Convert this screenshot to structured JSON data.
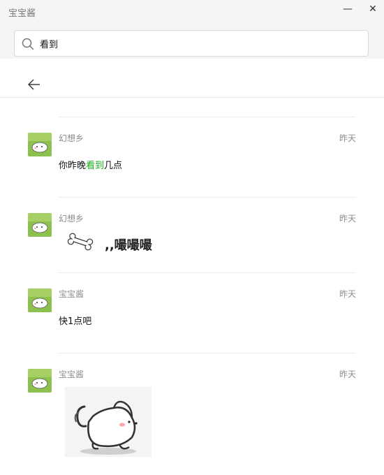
{
  "window": {
    "title": "宝宝酱",
    "minimize_glyph": "—",
    "close_glyph": "✕"
  },
  "search": {
    "value": "看到"
  },
  "messages": [
    {
      "sender": "幻想乡",
      "time": "昨天",
      "text_before": "你昨晚",
      "text_highlight": "看到",
      "text_after": "几点"
    },
    {
      "sender": "幻想乡",
      "time": "昨天",
      "sticker_text": ",,嘬嘬嘬"
    },
    {
      "sender": "宝宝酱",
      "time": "昨天",
      "text": "快1点吧"
    },
    {
      "sender": "宝宝酱",
      "time": "昨天"
    }
  ],
  "colors": {
    "highlight": "#1aad19",
    "avatar_bg": "#8cc04f"
  },
  "icons": [
    "search-icon",
    "back-arrow-icon",
    "bone-sticker-icon",
    "dog-sticker-image"
  ]
}
